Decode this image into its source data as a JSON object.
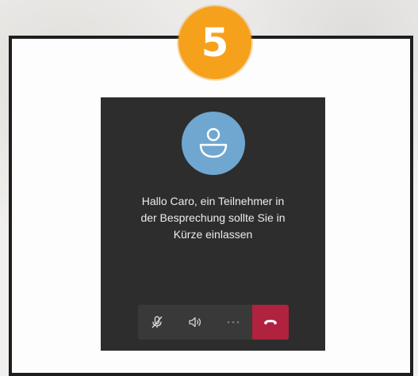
{
  "step": {
    "number": "5"
  },
  "lobby": {
    "message_lines": [
      "Hallo Caro, ein Teilnehmer in",
      "der Besprechung sollte Sie in",
      "Kürze einlassen"
    ]
  },
  "controls": {
    "items": [
      {
        "icon": "mic-off-icon"
      },
      {
        "icon": "speaker-icon"
      },
      {
        "icon": "more-options-icon"
      },
      {
        "icon": "hang-up-icon"
      }
    ]
  },
  "colors": {
    "badge": "#f6a11b",
    "screen_background": "#2d2d2d",
    "avatar": "#6fa7d1",
    "hangup": "#b0223d"
  }
}
